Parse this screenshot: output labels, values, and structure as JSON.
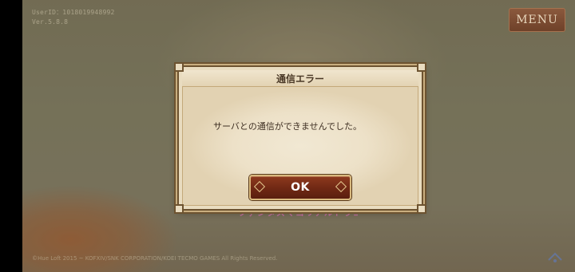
{
  "hud": {
    "user_id_line": "UserID：1018019948992",
    "version_line": "Ver.5.8.8",
    "menu_label": "MENU",
    "copyright": "©Hue Loft 2015 ~ KOFXIV/SNK CORPORATION/KOEI TECMO GAMES All Rights Reserved.",
    "logo_text": "ファンタズマゴリアルドラゴン"
  },
  "dialog": {
    "title": "通信エラー",
    "message": "サーバとの通信ができませんでした。",
    "ok_label": "OK"
  },
  "colors": {
    "dialog_border": "#6d5330",
    "ok_button": "#6f2814",
    "menu_button": "#7b4a32"
  }
}
